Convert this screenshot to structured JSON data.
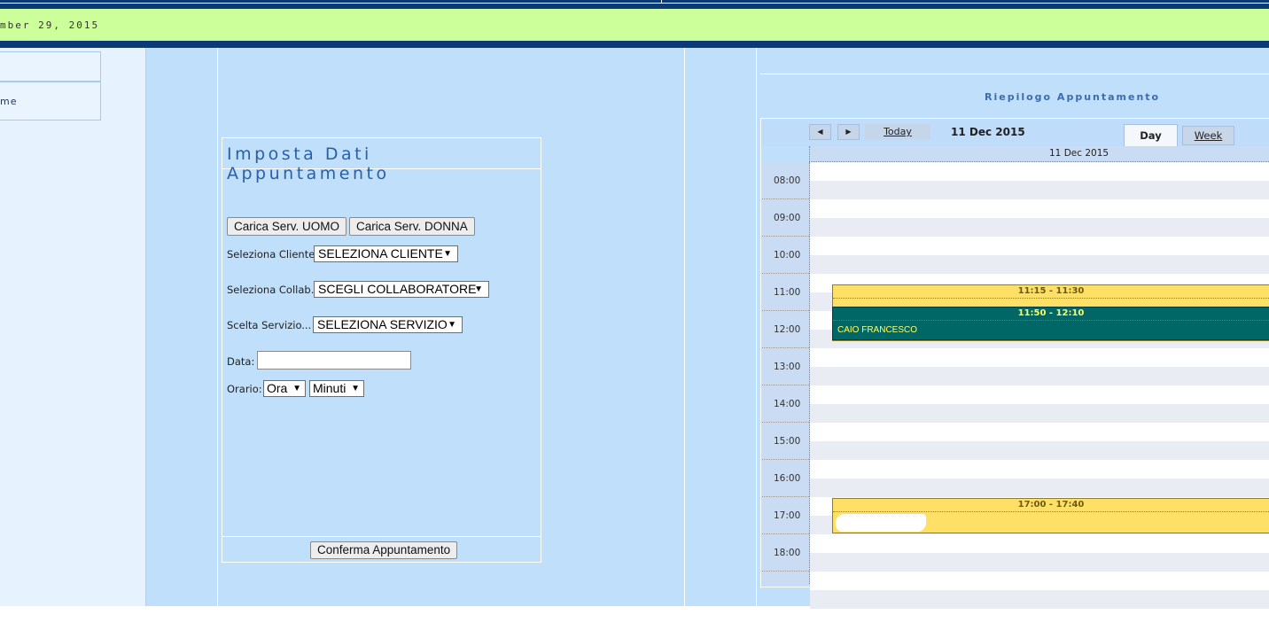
{
  "header": {
    "date_text": "mber 29, 2015"
  },
  "leftnav": {
    "items": [
      {
        "label": ""
      },
      {
        "label": "me"
      }
    ]
  },
  "form": {
    "title": "Imposta Dati Appuntamento",
    "load_men_button": "Carica Serv. UOMO",
    "load_women_button": "Carica Serv. DONNA",
    "client_label": "Seleziona Cliente",
    "client_value": "SELEZIONA CLIENTE",
    "collab_label": "Seleziona Collab.",
    "collab_value": "SCEGLI COLLABORATORE",
    "service_label": "Scelta Servizio...",
    "service_value": "SELEZIONA SERVIZIO",
    "date_label": "Data:",
    "date_value": "",
    "time_label": "Orario:",
    "hour_value": "Ora",
    "minute_value": "Minuti",
    "confirm_button": "Conferma Appuntamento"
  },
  "calendar": {
    "title": "Riepilogo Appuntamento",
    "prev_icon": "triangle-left-icon",
    "next_icon": "triangle-right-icon",
    "today_label": "Today",
    "current_date": "11 Dec 2015",
    "tabs": [
      {
        "label": "Day",
        "active": true
      },
      {
        "label": "Week",
        "active": false
      }
    ],
    "column_header": "11 Dec 2015",
    "hours": [
      "08:00",
      "09:00",
      "10:00",
      "11:00",
      "12:00",
      "13:00",
      "14:00",
      "15:00",
      "16:00",
      "17:00",
      "18:00"
    ],
    "events": [
      {
        "time": "11:15 - 11:30",
        "client": "",
        "color": "#ffe066"
      },
      {
        "time": "11:50 - 12:10",
        "client": "CAIO FRANCESCO",
        "color": "#006666"
      },
      {
        "time": "17:00 - 17:40",
        "client": "",
        "color": "#ffe066"
      }
    ]
  },
  "colors": {
    "navy": "#0b3a78",
    "lime": "#ccff99",
    "panel": "#bfdffa",
    "title_blue": "#2a5fa8"
  }
}
